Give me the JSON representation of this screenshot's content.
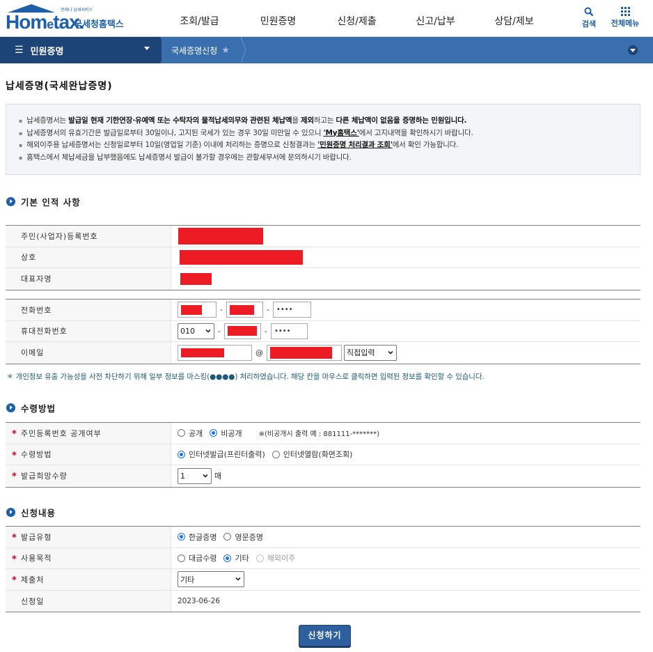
{
  "header": {
    "logo_tiny": "언제나 납세서비스",
    "logo_main_a": "Hom",
    "logo_main_e": "e",
    "logo_main_b": "tax.",
    "logo_sub": "국세청홈택스",
    "menu": [
      "조회/발급",
      "민원증명",
      "신청/제출",
      "신고/납부",
      "상담/제보"
    ],
    "search_label": "검색",
    "allmenu_label": "전체메뉴"
  },
  "subnav": {
    "section": "민원증명",
    "current": "국세증명신청"
  },
  "page_title": "납세증명(국세완납증명)",
  "notice": {
    "line1_a": "납세증명서는 ",
    "line1_b": "발급일 현재 기한연장·유예액 또는 수탁자의 물적납세의무와 관련된 체납액",
    "line1_c": "을 ",
    "line1_d": "제외",
    "line1_e": "하고는 ",
    "line1_f": "다른 체납액이 없음을 증명하는 민원입니다.",
    "line2_a": "납세증명서의 유효기간은 발급일로부터 30일이나, 고지된 국세가 있는 경우 30일 미만일 수 있으니 ",
    "line2_link": "'My홈택스'",
    "line2_b": "에서 고지내역을 확인하시기 바랍니다.",
    "line3_a": "해외이주용 납세증명서는 신청일로부터 10일(영업일 기준) 이내에 처리하는 증명으로 신청결과는 ",
    "line3_link": "'민원증명 처리결과 조회'",
    "line3_b": "에서 확인 가능합니다.",
    "line4": "홈택스에서 체납세금을 납부했음에도 납세증명서 발급이 불가할 경우에는 관할세무서에 문의하시기 바랍니다."
  },
  "section_basic": {
    "title": "기본 인적 사항",
    "labels": {
      "reg_no": "주민(사업자)등록번호",
      "company": "상호",
      "rep_name": "대표자명",
      "phone": "전화번호",
      "mobile": "휴대전화번호",
      "email": "이메일"
    },
    "phone_last": "••••",
    "mobile_prefix": "010",
    "mobile_last": "••••",
    "email_at": "@",
    "email_domain_select": "직접입력"
  },
  "mask_note": "＊ 개인정보 유출 가능성을 사전 차단하기 위해 일부 정보를 마스킹(●●●●) 처리하였습니다. 해당 칸을 마우스로 클릭하면 입력된 정보를 확인할 수 있습니다.",
  "section_receive": {
    "title": "수령방법",
    "labels": {
      "disclose": "주민등록번호 공개여부",
      "method": "수령방법",
      "quantity": "발급희망수량"
    },
    "disclose_options": [
      "공개",
      "비공개"
    ],
    "disclose_note": "※(비공개시 출력 예 : 881111-*******)",
    "method_options": [
      "인터넷발급(프린터출력)",
      "인터넷열람(화면조회)"
    ],
    "quantity_value": "1",
    "quantity_unit": "매"
  },
  "section_apply": {
    "title": "신청내용",
    "labels": {
      "type": "발급유형",
      "purpose": "사용목적",
      "submit_to": "제출처",
      "apply_date": "신청일"
    },
    "type_options": [
      "한글증명",
      "영문증명"
    ],
    "purpose_options": [
      "대금수령",
      "기타",
      "해외이주"
    ],
    "submit_to_value": "기타",
    "apply_date_value": "2023-06-26"
  },
  "submit_label": "신청하기",
  "colors": {
    "brand": "#1d5fa8",
    "subnav_dark": "#1d4477",
    "subnav": "#3a6fad",
    "mask": "#ed1c24",
    "required": "#d0021b",
    "button": "#2e5f9e"
  }
}
